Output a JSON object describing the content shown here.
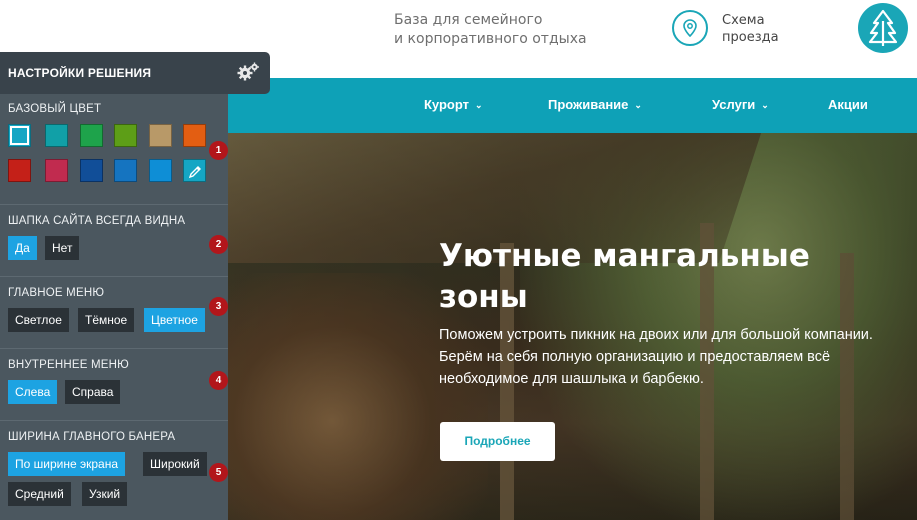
{
  "header": {
    "tagline_line1": "База для семейного",
    "tagline_line2": "и корпоративного отдыха",
    "route_line1": "Схема",
    "route_line2": "проезда",
    "accent_color": "#1aa6b7"
  },
  "nav": {
    "items": [
      {
        "label": "Курорт",
        "has_dropdown": true
      },
      {
        "label": "Проживание",
        "has_dropdown": true
      },
      {
        "label": "Услуги",
        "has_dropdown": true
      },
      {
        "label": "Акции",
        "has_dropdown": false
      }
    ],
    "chevron": "⌄",
    "bg_color": "#0ea1b7"
  },
  "hero": {
    "title_line1": "Уютные мангальные",
    "title_line2": "зоны",
    "text": "Поможем устроить пикник на двоих или для большой компании. Берём на себя полную организацию и предоставляем всё необходимое для шашлыка и барбекю.",
    "button_label": "Подробнее"
  },
  "settings": {
    "title": "НАСТРОЙКИ РЕШЕНИЯ",
    "icon": "gears-icon",
    "sections": [
      {
        "label": "БАЗОВЫЙ ЦВЕТ",
        "badge": "1",
        "colors": [
          "#15a6c4",
          "#11a0a7",
          "#1ea34b",
          "#5d9e17",
          "#b89968",
          "#e35e12",
          "#c42018",
          "#c12b4f",
          "#114e98",
          "#1574c0",
          "#0e8ed6",
          "#15a6c4"
        ],
        "selected_index": 0,
        "picker_icon": "eyedropper-icon"
      },
      {
        "label": "ШАПКА САЙТА ВСЕГДА ВИДНА",
        "badge": "2",
        "options": [
          {
            "label": "Да",
            "active": true
          },
          {
            "label": "Нет",
            "active": false
          }
        ]
      },
      {
        "label": "ГЛАВНОЕ МЕНЮ",
        "badge": "3",
        "options": [
          {
            "label": "Светлое",
            "active": false
          },
          {
            "label": "Тёмное",
            "active": false
          },
          {
            "label": "Цветное",
            "active": true
          }
        ]
      },
      {
        "label": "ВНУТРЕННЕЕ МЕНЮ",
        "badge": "4",
        "options": [
          {
            "label": "Слева",
            "active": true
          },
          {
            "label": "Справа",
            "active": false
          }
        ]
      },
      {
        "label": "ШИРИНА ГЛАВНОГО БАНЕРА",
        "badge": "5",
        "options": [
          {
            "label": "По ширине экрана",
            "active": true
          },
          {
            "label": "Широкий",
            "active": false
          },
          {
            "label": "Средний",
            "active": false
          },
          {
            "label": "Узкий",
            "active": false
          }
        ]
      }
    ]
  }
}
